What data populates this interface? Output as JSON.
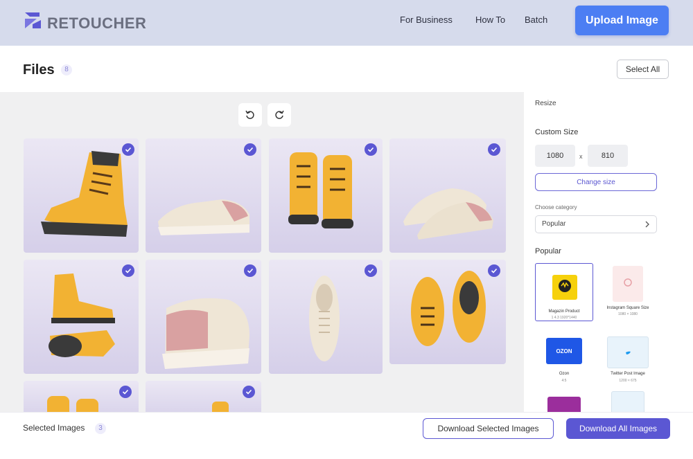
{
  "header": {
    "brand": "RETOUCHER",
    "nav": [
      "For Business",
      "How To",
      "Batch"
    ],
    "upload_label": "Upload Image"
  },
  "files": {
    "title": "Files",
    "count": "8",
    "select_all_label": "Select All"
  },
  "workspace": {
    "rotate_left_icon": "rotate-left-icon",
    "rotate_right_icon": "rotate-right-icon",
    "images": [
      {
        "subject": "yellow boot side view",
        "selected": true
      },
      {
        "subject": "white sneaker side view",
        "selected": true
      },
      {
        "subject": "pair of yellow boots front",
        "selected": true
      },
      {
        "subject": "pair of white sneakers",
        "selected": true
      },
      {
        "subject": "yellow boots top and sole",
        "selected": true
      },
      {
        "subject": "sneaker heel view",
        "selected": true
      },
      {
        "subject": "sneaker top view",
        "selected": true
      },
      {
        "subject": "boots top view pair",
        "selected": true
      },
      {
        "subject": "pair of boots",
        "selected": true
      },
      {
        "subject": "boot",
        "selected": true
      }
    ]
  },
  "sidebar": {
    "section_title": "Resize",
    "custom_size_label": "Custom Size",
    "width_value": "1080",
    "height_value": "810",
    "size_separator": "x",
    "change_size_label": "Change size",
    "category_label": "Choose category",
    "category_value": "Popular",
    "popular_label": "Popular",
    "presets": [
      {
        "name": "Magazin Product",
        "size": "1 4.3 1920*1440"
      },
      {
        "name": "Instagram Square Size",
        "size": "1080 × 1080"
      },
      {
        "name": "Ozon",
        "size": "4:5"
      },
      {
        "name": "Twitter Post Image",
        "size": "1200 × 675"
      }
    ],
    "ozon_logo_text": "OZON"
  },
  "footer": {
    "selected_label": "Selected Images",
    "selected_count": "3",
    "download_selected_label": "Download Selected Images",
    "download_all_label": "Download All Images"
  },
  "colors": {
    "accent": "#5b57d3",
    "upload_button": "#4c7ef3",
    "header_bg": "#d6dbec"
  }
}
